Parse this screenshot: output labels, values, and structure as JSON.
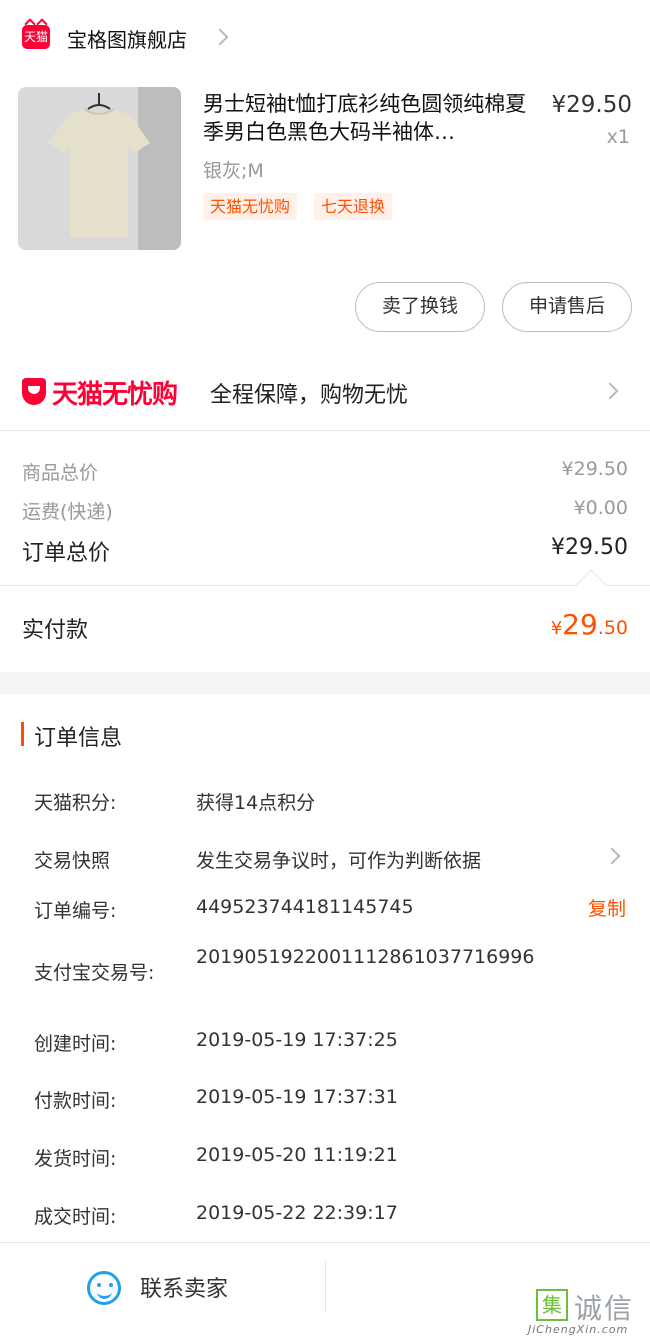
{
  "store": {
    "badge": "天猫",
    "name": "宝格图旗舰店"
  },
  "product": {
    "title": "男士短袖t恤打底衫纯色圆领纯棉夏季男白色黑色大码半袖体…",
    "price": "¥29.50",
    "qty": "x1",
    "sku": "银灰;M",
    "tags": [
      "天猫无忧购",
      "七天退换"
    ]
  },
  "actions": {
    "exchange": "卖了换钱",
    "after_sale": "申请售后"
  },
  "guarantee": {
    "brand": "天猫无忧购",
    "text": "全程保障，购物无忧"
  },
  "price_summary": {
    "goods_label": "商品总价",
    "goods_value": "¥29.50",
    "shipping_label": "运费(快递)",
    "shipping_value": "¥0.00",
    "total_label": "订单总价",
    "total_value": "¥29.50",
    "paid_label": "实付款",
    "paid_currency": "¥",
    "paid_int": "29",
    "paid_dec": ".50"
  },
  "order_info": {
    "title": "订单信息",
    "rows": [
      {
        "label": "天猫积分:",
        "value": "获得14点积分"
      },
      {
        "label": "交易快照",
        "value": "发生交易争议时，可作为判断依据"
      },
      {
        "label": "订单编号:",
        "value": "449523744181145745"
      },
      {
        "label": "支付宝交易号:",
        "value": "2019051922001112861037716996"
      },
      {
        "label": "创建时间:",
        "value": "2019-05-19 17:37:25"
      },
      {
        "label": "付款时间:",
        "value": "2019-05-19 17:37:31"
      },
      {
        "label": "发货时间:",
        "value": "2019-05-20 11:19:21"
      },
      {
        "label": "成交时间:",
        "value": "2019-05-22 22:39:17"
      }
    ],
    "copy_label": "复制"
  },
  "bottom": {
    "contact_label": "联系卖家"
  },
  "watermark": {
    "box": "集",
    "chars": "诚信",
    "url": "JiChengXin.com"
  },
  "colors": {
    "tmall_red": "#ff0036",
    "accent_orange": "#ff5000",
    "contact_blue": "#1ea1ee"
  }
}
